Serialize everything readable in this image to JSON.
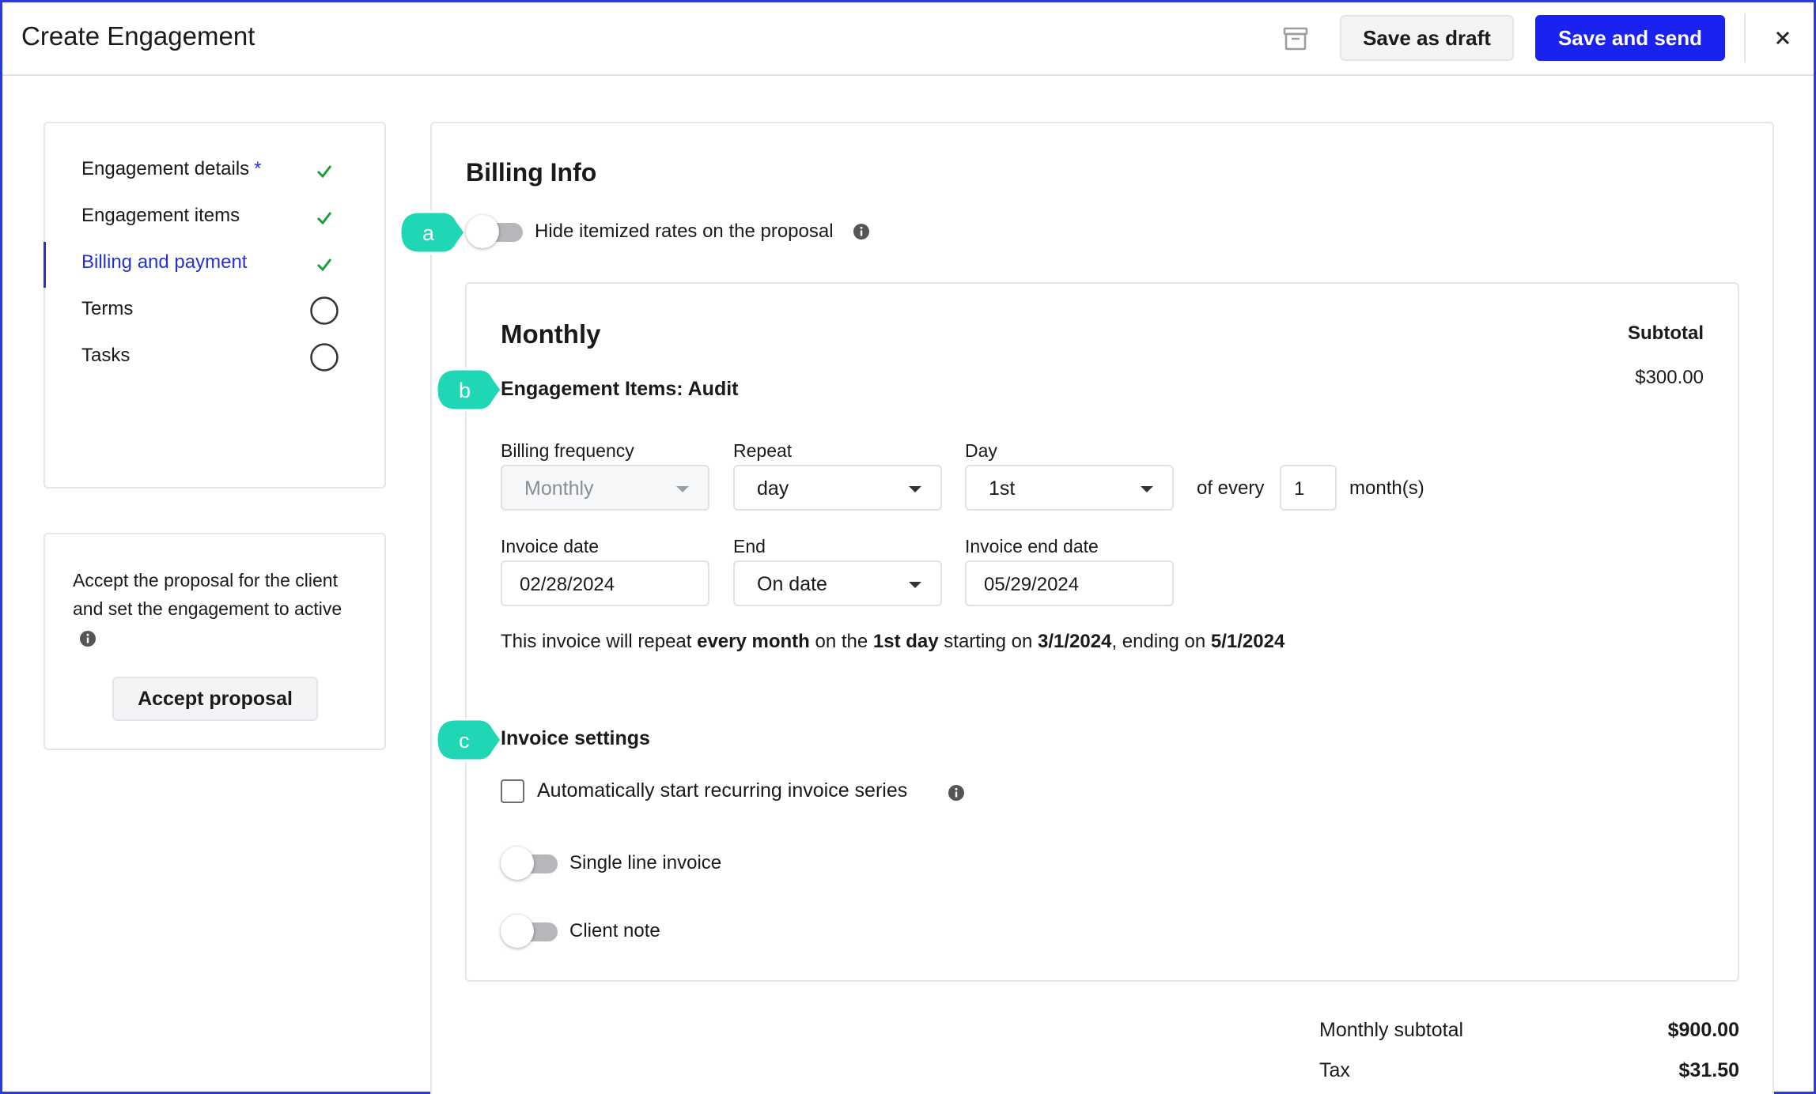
{
  "header": {
    "title": "Create Engagement",
    "save_draft_label": "Save as draft",
    "save_send_label": "Save and send",
    "accent_color": "#1a22f0"
  },
  "sidebar": {
    "items": [
      {
        "label": "Engagement details",
        "required_mark": "*",
        "status": "complete"
      },
      {
        "label": "Engagement items",
        "status": "complete"
      },
      {
        "label": "Billing and payment",
        "status": "complete",
        "active": true
      },
      {
        "label": "Terms",
        "status": "incomplete"
      },
      {
        "label": "Tasks",
        "status": "incomplete"
      }
    ]
  },
  "accept": {
    "text": "Accept the proposal for the client and set the engagement to active",
    "button_label": "Accept proposal"
  },
  "billing": {
    "title": "Billing Info",
    "hide_rates_label": "Hide itemized rates on the proposal",
    "hide_rates_on": false,
    "callouts": [
      "a",
      "b",
      "c"
    ],
    "callout_color": "#1fd6b5",
    "monthly": {
      "title": "Monthly",
      "subtotal_label": "Subtotal",
      "subtotal_value": "$300.00",
      "items_title": "Engagement Items: Audit",
      "billing_frequency_label": "Billing frequency",
      "billing_frequency_value": "Monthly",
      "repeat_label": "Repeat",
      "repeat_value": "day",
      "day_label": "Day",
      "day_value": "1st",
      "of_every": "of every",
      "every_n": "1",
      "months_unit": "month(s)",
      "invoice_date_label": "Invoice date",
      "invoice_date_value": "02/28/2024",
      "end_label": "End",
      "end_value": "On date",
      "invoice_end_date_label": "Invoice end date",
      "invoice_end_date_value": "05/29/2024",
      "summary": {
        "p1": "This invoice will repeat ",
        "b1": "every month",
        "p2": " on the ",
        "b2": "1st day",
        "p3": " starting on ",
        "b3": "3/1/2024",
        "p4": ", ending on ",
        "b4": "5/1/2024"
      },
      "settings_title": "Invoice settings",
      "auto_start_label": "Automatically start recurring invoice series",
      "auto_start_checked": false,
      "single_line_label": "Single line invoice",
      "single_line_on": false,
      "client_note_label": "Client note",
      "client_note_on": false
    },
    "totals": {
      "monthly_subtotal_label": "Monthly subtotal",
      "monthly_subtotal_value": "$900.00",
      "tax_label": "Tax",
      "tax_value": "$31.50"
    }
  }
}
